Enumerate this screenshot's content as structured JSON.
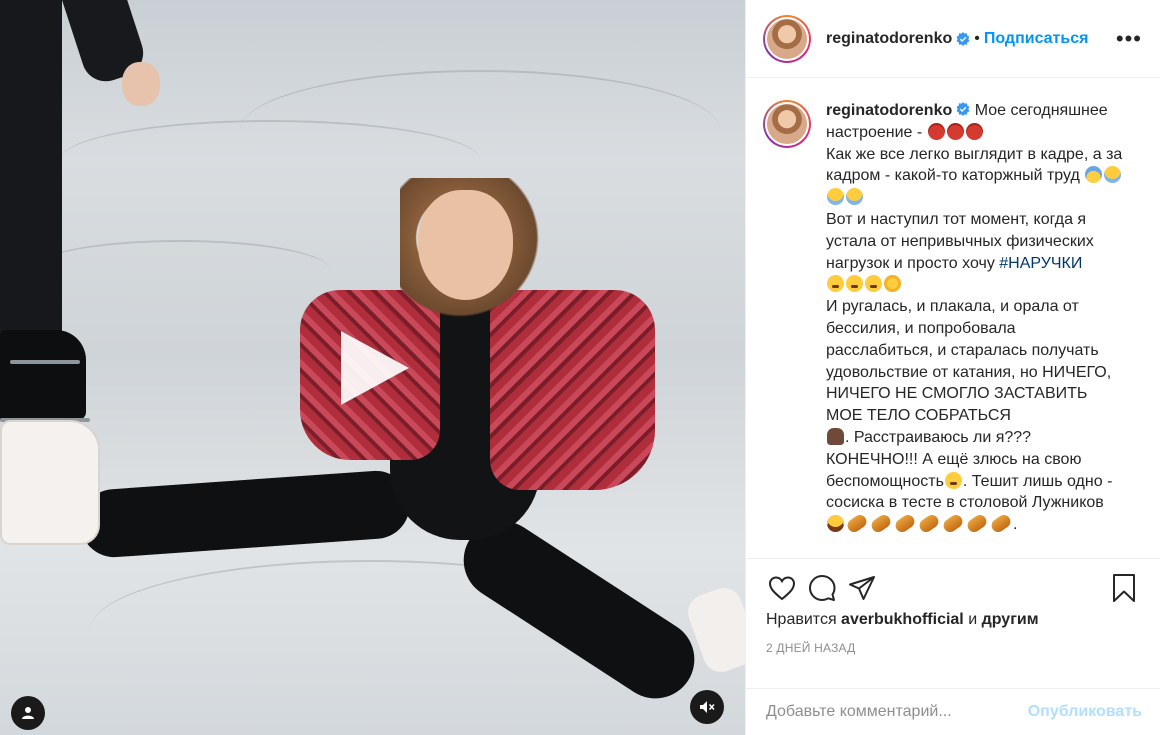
{
  "header": {
    "username": "reginatodorenko",
    "separator": "•",
    "follow_label": "Подписаться",
    "more_label": "•••"
  },
  "caption": {
    "username": "reginatodorenko",
    "line1": "Мое сегодняшнее настроение - ",
    "line2": "Как же все легко выглядит в кадре, а за кадром - какой-то каторжный труд ",
    "line3": "Вот и наступил тот момент, когда я устала от непривычных физических нагрузок и просто хочу ",
    "hashtag": "#НАРУЧКИ",
    "line4": "И ругалась, и плакала, и орала от бессилия, и попробовала расслабиться, и старалась получать удовольствие от катания, но НИЧЕГО, НИЧЕГО НЕ СМОГЛО ЗАСТАВИТЬ МОЕ ТЕЛО СОБРАТЬСЯ ",
    "line5a": ". Расстраиваюсь ли я??? КОНЕЧНО!!! А ещё злюсь на свою беспомощность",
    "line5b": ". Тешит лишь одно - сосиска в тесте в столовой Лужников ",
    "end": "."
  },
  "likes": {
    "prefix": "Нравится ",
    "user": "averbukhofficial",
    "suffix": " и ",
    "others": "другим"
  },
  "date": "2 дней назад",
  "comment": {
    "placeholder": "Добавьте комментарий...",
    "publish_label": "Опубликовать"
  },
  "icons": {
    "like": "heart-icon",
    "comment": "comment-icon",
    "share": "paper-plane-icon",
    "save": "bookmark-icon",
    "play": "play-icon",
    "user": "user-icon",
    "mute": "speaker-muted-icon",
    "verified": "verified-badge-icon"
  },
  "colors": {
    "accent": "#0095f6",
    "publish_disabled": "#b2dffc",
    "hashtag": "#00376b",
    "muted_text": "#8e8e8e"
  }
}
